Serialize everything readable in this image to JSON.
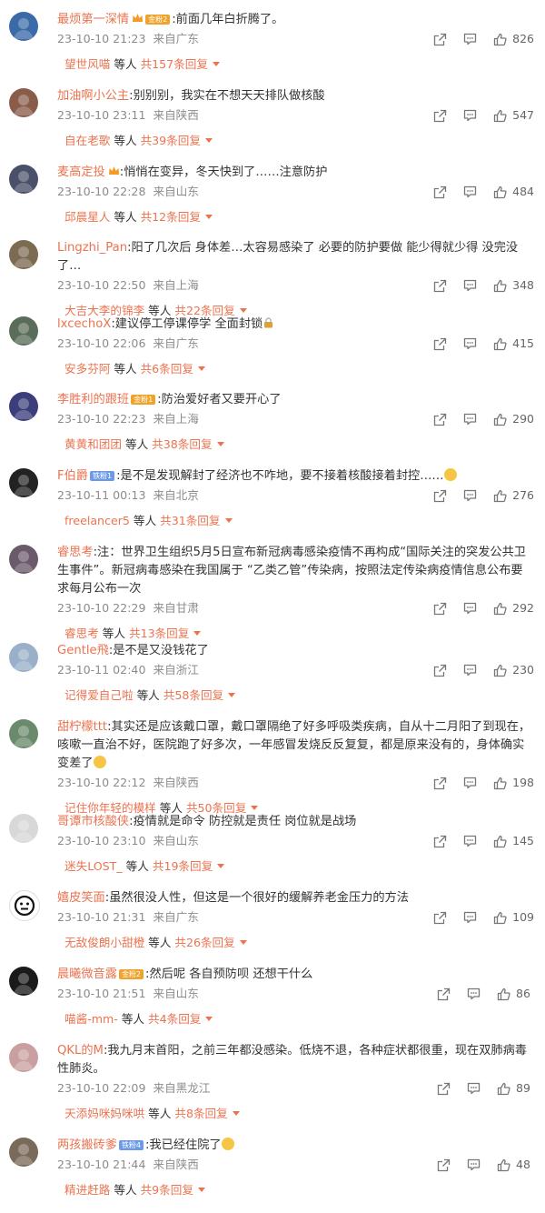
{
  "comments": [
    {
      "user": "最烦第一深情",
      "badge": "金粉2",
      "badge_color": "gold",
      "crown": true,
      "text": ":前面几年白折腾了。",
      "time": "23-10-10 21:23",
      "loc": "来自广东",
      "likes": "826",
      "reply_name": "望世风喵",
      "reply_mid": "等人",
      "reply_count": "共157条回复",
      "avatar": "#3a6aa8"
    },
    {
      "user": "加油啊小公主",
      "badge": "",
      "crown": false,
      "text": ":别别别，我实在不想天天排队做核酸",
      "time": "23-10-10 23:11",
      "loc": "来自陕西",
      "likes": "547",
      "reply_name": "自在老歌",
      "reply_mid": "等人",
      "reply_count": "共39条回复",
      "avatar": "#8a5d4a"
    },
    {
      "user": "麦高定投",
      "badge": "",
      "crown": true,
      "text": ":悄悄在变异，冬天快到了……注意防护",
      "time": "23-10-10 22:28",
      "loc": "来自山东",
      "likes": "484",
      "reply_name": "邱晨星人",
      "reply_mid": "等人",
      "reply_count": "共12条回复",
      "avatar": "#4a4f6a"
    },
    {
      "user": "Lingzhi_Pan",
      "badge": "",
      "crown": false,
      "text": ":阳了几次后 身体差…太容易感染了 必要的防护要做 能少得就少得 没完没了…",
      "time": "23-10-10 22:50",
      "loc": "来自上海",
      "likes": "348",
      "reply_name": "大吉大李的锦李",
      "reply_mid": "等人",
      "reply_count": "共22条回复",
      "avatar": "#7d6a52"
    },
    {
      "user": "lxcechoX",
      "badge": "",
      "crown": false,
      "text": ":建议停工停课停学 全面封锁",
      "lock": true,
      "time": "23-10-10 22:06",
      "loc": "来自广东",
      "likes": "415",
      "reply_name": "安多芬阿",
      "reply_mid": "等人",
      "reply_count": "共6条回复",
      "avatar": "#5a6d5a"
    },
    {
      "user": "李胜利的跟班",
      "badge": "金粉1",
      "badge_color": "gold",
      "crown": false,
      "text": ":防治爱好者又要开心了",
      "time": "23-10-10 22:23",
      "loc": "来自上海",
      "likes": "290",
      "reply_name": "黄黄和团团",
      "reply_mid": "等人",
      "reply_count": "共38条回复",
      "avatar": "#3b3e7a"
    },
    {
      "user": "F伯爵",
      "badge": "铁粉1",
      "badge_color": "blue",
      "crown": false,
      "text": ":是不是发现解封了经济也不咋地，要不接着核酸接着封控……",
      "emoji": true,
      "time": "23-10-11 00:13",
      "loc": "来自北京",
      "likes": "276",
      "reply_name": "freelancer5",
      "reply_mid": "等人",
      "reply_count": "共31条回复",
      "avatar": "#222222"
    },
    {
      "user": "睿思考",
      "badge": "",
      "crown": false,
      "text": ":注：世界卫生组织5月5日宣布新冠病毒感染疫情不再构成“国际关注的突发公共卫生事件”。新冠病毒感染在我国属于 “乙类乙管”传染病，按照法定传染病疫情信息公布要求每月公布一次",
      "time": "23-10-10 22:29",
      "loc": "来自甘肃",
      "likes": "292",
      "reply_name": "睿思考",
      "reply_mid": "等人",
      "reply_count": "共13条回复",
      "avatar": "#6a5a6a"
    },
    {
      "user": "Gentle飛",
      "badge": "",
      "crown": false,
      "text": ":是不是又没钱花了",
      "time": "23-10-11 02:40",
      "loc": "来自浙江",
      "likes": "230",
      "reply_name": "记得爱自己啦",
      "reply_mid": "等人",
      "reply_count": "共58条回复",
      "avatar": "#9ab0c8"
    },
    {
      "user": "甜柠檬ttt",
      "badge": "",
      "crown": false,
      "text": ":其实还是应该戴口罩，戴口罩隔绝了好多呼吸类疾病，自从十二月阳了到现在，咳嗽一直治不好，医院跑了好多次，一年感冒发烧反反复复，都是原来没有的，身体确实变差了",
      "emoji": true,
      "time": "23-10-10 22:12",
      "loc": "来自陕西",
      "likes": "198",
      "reply_name": "记住你年轻的模样",
      "reply_mid": "等人",
      "reply_count": "共50条回复",
      "avatar": "#6b8a6b"
    },
    {
      "user": "哥谭市核酸侠",
      "badge": "",
      "crown": false,
      "text": ":疫情就是命令 防控就是责任 岗位就是战场",
      "time": "23-10-10 23:10",
      "loc": "来自山东",
      "likes": "145",
      "reply_name": "迷失LOST_",
      "reply_mid": "等人",
      "reply_count": "共19条回复",
      "avatar": "#d8d8d8"
    },
    {
      "user": "嬉皮笑面",
      "badge": "",
      "crown": false,
      "text": ":虽然很没人性，但这是一个很好的缓解养老金压力的方法",
      "time": "23-10-10 21:31",
      "loc": "来自广东",
      "likes": "109",
      "reply_name": "无敌俊朗小甜橙",
      "reply_mid": "等人",
      "reply_count": "共26条回复",
      "avatar": "#ffffff"
    },
    {
      "user": "晨曦微音露",
      "badge": "金粉2",
      "badge_color": "gold",
      "crown": false,
      "text": ":然后呢 各自预防呗 还想干什么",
      "time": "23-10-10 21:51",
      "loc": "来自山东",
      "likes": "86",
      "reply_name": "喵酱-mm-",
      "reply_mid": "等人",
      "reply_count": "共4条回复",
      "avatar": "#1a1a1a"
    },
    {
      "user": "QKL的M",
      "badge": "",
      "crown": false,
      "text": ":我九月末首阳，之前三年都没感染。低烧不退，各种症状都很重，现在双肺病毒性肺炎。",
      "time": "23-10-10 22:09",
      "loc": "来自黑龙江",
      "likes": "89",
      "reply_name": "天添妈咪妈咪哄",
      "reply_mid": "等人",
      "reply_count": "共8条回复",
      "avatar": "#c9a0a0"
    },
    {
      "user": "两孩搬砖爹",
      "badge": "铁粉4",
      "badge_color": "blue",
      "crown": false,
      "text": ":我已经住院了",
      "emoji": true,
      "time": "23-10-10 21:44",
      "loc": "来自陕西",
      "likes": "48",
      "reply_name": "精进赶路",
      "reply_mid": "等人",
      "reply_count": "共9条回复",
      "avatar": "#7a6a5a"
    }
  ]
}
